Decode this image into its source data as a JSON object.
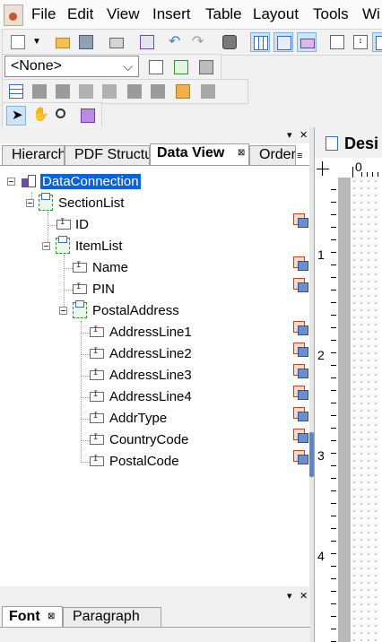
{
  "menu": {
    "items": [
      "File",
      "Edit",
      "View",
      "Insert",
      "Table",
      "Layout",
      "Tools",
      "Wi"
    ]
  },
  "toolbar": {
    "style_combo_value": "<None>"
  },
  "panel": {
    "tabs": [
      "Hierarch",
      "PDF Structu",
      "Data View",
      "Order"
    ],
    "active_tab": "Data View"
  },
  "tree": {
    "root": "DataConnection",
    "section_list": "SectionList",
    "id": "ID",
    "item_list": "ItemList",
    "name": "Name",
    "pin": "PIN",
    "postal_address": "PostalAddress",
    "address_line1": "AddressLine1",
    "address_line2": "AddressLine2",
    "address_line3": "AddressLine3",
    "address_line4": "AddressLine4",
    "addr_type": "AddrType",
    "country_code": "CountryCode",
    "postal_code": "PostalCode"
  },
  "design": {
    "tab_label": "Desi",
    "ruler_h_zero": "0",
    "ruler_v": [
      "1",
      "2",
      "3",
      "4"
    ]
  },
  "bottom_panel": {
    "tabs": [
      "Font",
      "Paragraph"
    ],
    "active_tab": "Font"
  }
}
